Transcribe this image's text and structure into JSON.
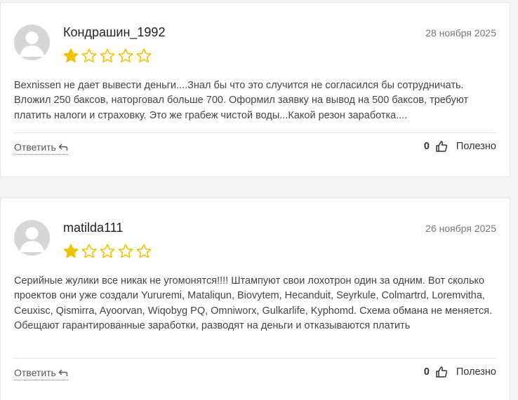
{
  "reviews": [
    {
      "author": "Кондрашин_1992",
      "date": "28 ноября 2025",
      "rating": 1,
      "max_rating": 5,
      "text": "Bexnissen не дает вывести деньги....Знал бы что это случится не согласился бы сотрудничать. Вложил 250 баксов, наторговал больше 700. Оформил заявку на вывод на 500 баксов, требуют платить налоги и страховку. Это же грабеж чистой воды...Какой резон заработка....",
      "reply_label": "Ответить",
      "likes": "0",
      "helpful_label": "Полезно"
    },
    {
      "author": "matilda111",
      "date": "26 ноября 2025",
      "rating": 1,
      "max_rating": 5,
      "text": "Серийные жулики все никак не угомонятся!!!! Штампуют свои лохотрон один за одним. Вот сколько проектов они уже создали Yururemi, Mataliqun, Biovytem, Hecanduit, Seyrkule, Colmartrd, Loremvitha, Ceuxisc, Qismirra, Ayoorvan, Wiqobyg PQ, Omniworx, Gulkarlife, Kyphomd. Схема обмана не меняется. Обещают гарантированные заработки, разводят на деньги и отказываются платить",
      "reply_label": "Ответить",
      "likes": "0",
      "helpful_label": "Полезно"
    }
  ],
  "colors": {
    "star_filled": "#f2c200",
    "star_outline": "#f2c200",
    "avatar_bg": "#d6d6d6"
  }
}
